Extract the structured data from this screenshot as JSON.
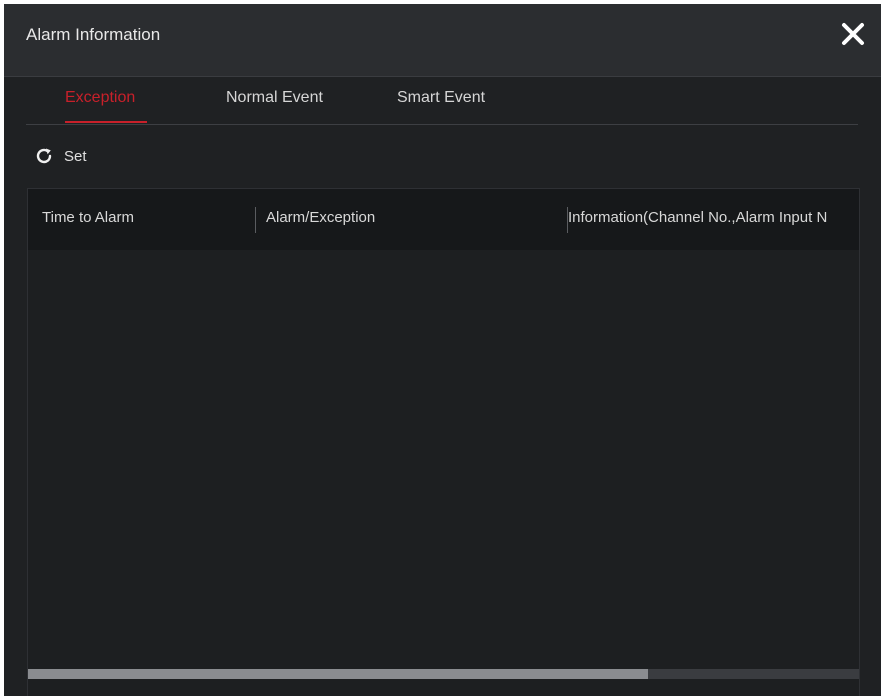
{
  "dialog": {
    "title": "Alarm Information"
  },
  "tabs": [
    {
      "label": "Exception",
      "active": true
    },
    {
      "label": "Normal Event",
      "active": false
    },
    {
      "label": "Smart Event",
      "active": false
    }
  ],
  "toolbar": {
    "set_label": "Set",
    "set_icon": "refresh-icon"
  },
  "table": {
    "columns": [
      "Time to Alarm",
      "Alarm/Exception",
      "Information(Channel No.,Alarm Input N"
    ],
    "rows": []
  },
  "colors": {
    "accent": "#c8202a",
    "background": "#1f2123",
    "header": "#2b2d30"
  }
}
